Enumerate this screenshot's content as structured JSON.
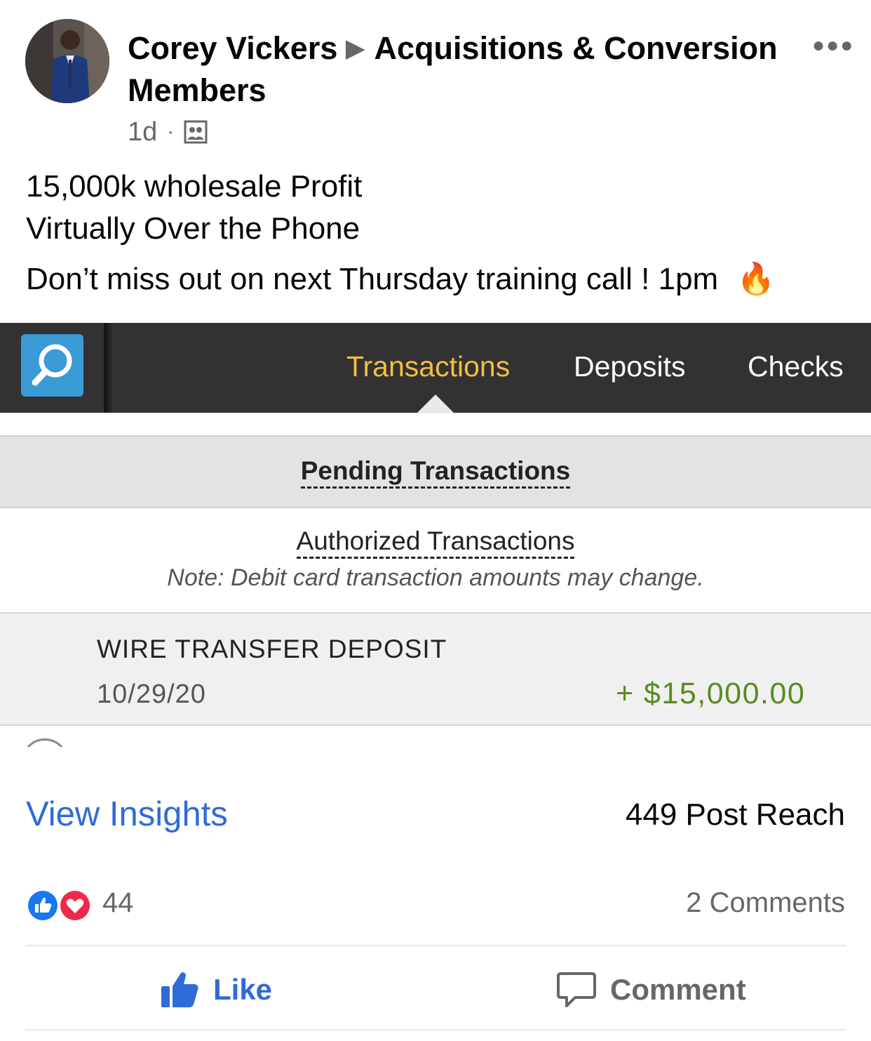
{
  "post": {
    "author": "Corey Vickers",
    "group": "Acquisitions & Conversion",
    "group_line2": "Members",
    "time": "1d",
    "text_lines": [
      "15,000k wholesale Profit",
      "Virtually Over the Phone",
      "Don’t miss out on next Thursday training call ! 1pm"
    ],
    "emoji": "🔥"
  },
  "bank_screenshot": {
    "tabs": [
      "Transactions",
      "Deposits",
      "Checks"
    ],
    "active_tab": "Transactions",
    "pending_title": "Pending Transactions",
    "authorized_title": "Authorized Transactions",
    "note": "Note: Debit card transaction amounts may change.",
    "transaction": {
      "description": "WIRE TRANSFER DEPOSIT",
      "date": "10/29/20",
      "amount": "+ $15,000.00"
    },
    "colors": {
      "nav_bg": "#323232",
      "active_tab": "#f2be43",
      "amount": "#5a8a1f",
      "search_bg": "#3a9bd6"
    }
  },
  "insights": {
    "link": "View Insights",
    "reach": "449 Post Reach"
  },
  "reactions": {
    "count": "44",
    "comments": "2 Comments",
    "icons": [
      "like-icon",
      "love-icon"
    ]
  },
  "actions": {
    "like": "Like",
    "comment": "Comment"
  },
  "colors": {
    "link_blue": "#2f6bd7",
    "secondary_text": "#65676b"
  }
}
